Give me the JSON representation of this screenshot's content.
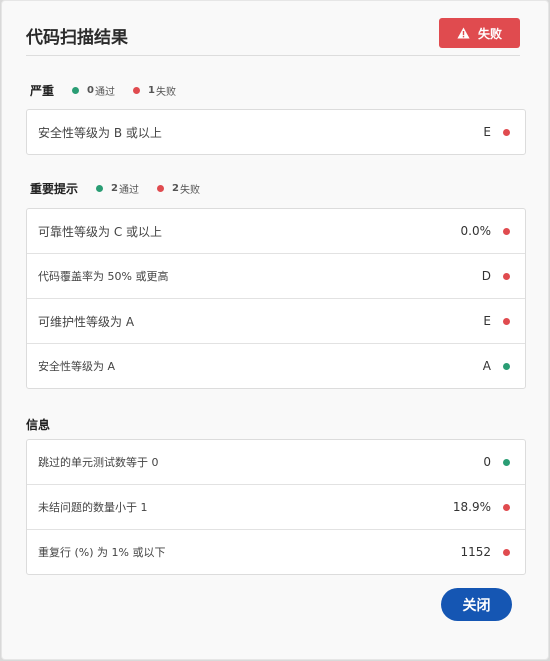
{
  "dialog": {
    "title": "代码扫描结果",
    "status_badge": {
      "label": "失败",
      "icon": "warning-icon",
      "color": "#e04b4f"
    }
  },
  "colors": {
    "pass": "#2a9d74",
    "fail": "#e04b4f",
    "primary": "#1556b3"
  },
  "sections": [
    {
      "title": "严重",
      "pass_count": "0",
      "pass_label": "通过",
      "fail_count": "1",
      "fail_label": "失败",
      "rows": [
        {
          "label": "安全性等级为 B 或以上",
          "value": "E",
          "status": "fail"
        }
      ]
    },
    {
      "title": "重要提示",
      "pass_count": "2",
      "pass_label": "通过",
      "fail_count": "2",
      "fail_label": "失败",
      "rows": [
        {
          "label": "可靠性等级为 C 或以上",
          "value": "0.0%",
          "status": "fail"
        },
        {
          "label": "代码覆盖率为 50% 或更高",
          "value": "D",
          "status": "fail"
        },
        {
          "label": "可维护性等级为 A",
          "value": "E",
          "status": "fail"
        },
        {
          "label": "安全性等级为 A",
          "value": "A",
          "status": "pass"
        }
      ]
    },
    {
      "title": "信息",
      "rows": [
        {
          "label": "跳过的单元测试数等于 0",
          "value": "0",
          "status": "pass"
        },
        {
          "label": "未结问题的数量小于 1",
          "value": "18.9%",
          "status": "fail"
        },
        {
          "label": "重复行 (%) 为 1% 或以下",
          "value": "1152",
          "status": "fail"
        }
      ]
    }
  ],
  "footer": {
    "close_label": "关闭"
  }
}
